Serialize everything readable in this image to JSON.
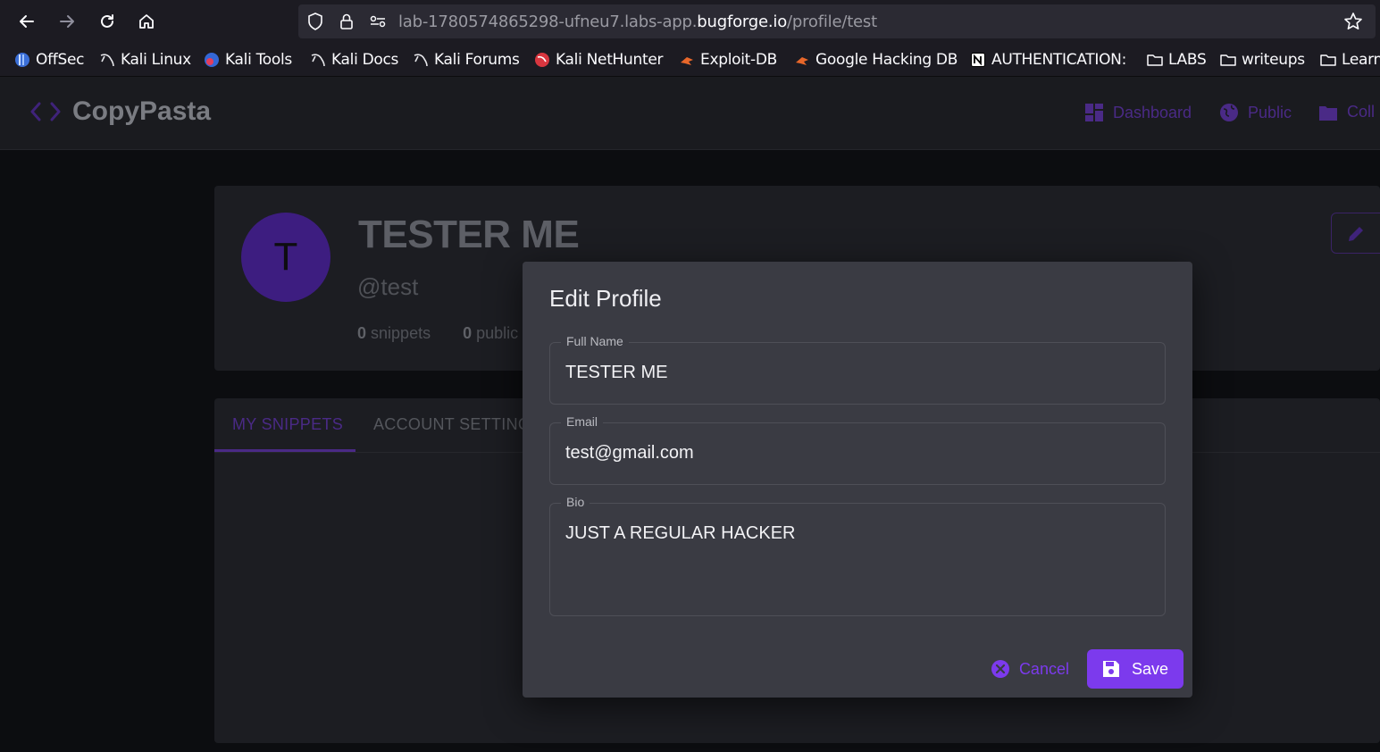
{
  "browser": {
    "url_prefix": "lab-1780574865298-ufneu7.labs-app.",
    "url_domain": "bugforge.io",
    "url_path": "/profile/test"
  },
  "bookmarks": [
    {
      "label": "OffSec",
      "icon": "offsec-icon"
    },
    {
      "label": "Kali Linux",
      "icon": "kali-icon"
    },
    {
      "label": "Kali Tools",
      "icon": "kali-tools-icon"
    },
    {
      "label": "Kali Docs",
      "icon": "kali-icon"
    },
    {
      "label": "Kali Forums",
      "icon": "kali-icon"
    },
    {
      "label": "Kali NetHunter",
      "icon": "nethunter-icon"
    },
    {
      "label": "Exploit-DB",
      "icon": "exploitdb-icon"
    },
    {
      "label": "Google Hacking DB",
      "icon": "exploitdb-icon"
    },
    {
      "label": "AUTHENTICATION:",
      "icon": "notion-icon"
    },
    {
      "label": "LABS",
      "icon": "folder-icon"
    },
    {
      "label": "writeups",
      "icon": "folder-icon"
    },
    {
      "label": "Learn",
      "icon": "folder-icon"
    }
  ],
  "app": {
    "logo_text": "CopyPasta",
    "nav": [
      "Dashboard",
      "Public",
      "Coll"
    ]
  },
  "profile": {
    "avatar_initial": "T",
    "name": "TESTER ME",
    "handle": "@test",
    "snippets_count": "0",
    "snippets_label": "snippets",
    "public_count": "0",
    "public_label": "public"
  },
  "tabs": [
    "MY SNIPPETS",
    "ACCOUNT SETTING"
  ],
  "modal": {
    "title": "Edit Profile",
    "full_name_label": "Full Name",
    "full_name_value": "TESTER ME",
    "email_label": "Email",
    "email_value": "test@gmail.com",
    "bio_label": "Bio",
    "bio_value": "JUST A REGULAR HACKER",
    "cancel_label": "Cancel",
    "save_label": "Save"
  },
  "colors": {
    "accent": "#7c3aed",
    "modal_bg": "#3a3b43"
  }
}
